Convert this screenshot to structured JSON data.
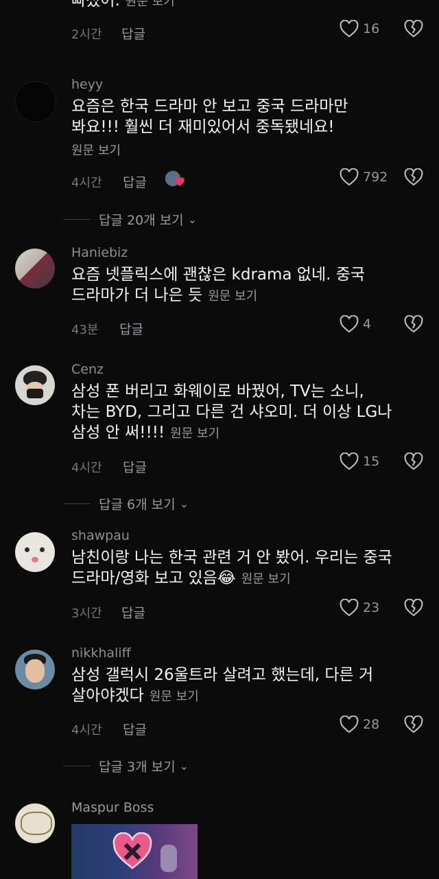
{
  "comments": [
    {
      "user": "",
      "text": "빠졌어.",
      "view_original": "원문 보기",
      "time": "2시간",
      "reply": "답글",
      "likes": "16"
    },
    {
      "user": "heyy",
      "text_line1": "요즘은 한국 드라마 안 보고 중국 드라마만",
      "text_line2": "봐요!!! 훨씬 더 재미있어서 중독됐네요!",
      "view_original": "원문 보기",
      "time": "4시간",
      "reply": "답글",
      "likes": "792",
      "view_replies": "답글 20개 보기"
    },
    {
      "user": "Haniebiz",
      "text_line1": "요즘 넷플릭스에 괜찮은 kdrama 없네. 중국",
      "text_line2": "드라마가 더 나은 듯",
      "view_original": "원문 보기",
      "time": "43분",
      "reply": "답글",
      "likes": "4"
    },
    {
      "user": "Cenz",
      "text_line1": "삼성 폰 버리고 화웨이로 바꿨어, TV는 소니,",
      "text_line2": "차는 BYD, 그리고 다른 건 샤오미. 더 이상 LG나",
      "text_line3": "삼성 안 써!!!!",
      "view_original": "원문 보기",
      "time": "4시간",
      "reply": "답글",
      "likes": "15",
      "view_replies": "답글 6개 보기"
    },
    {
      "user": "shawpau",
      "text_line1": "남친이랑 나는 한국 관련 거 안 봤어. 우리는 중국",
      "text_line2": "드라마/영화 보고 있음",
      "emoji": "😂",
      "view_original": "원문 보기",
      "time": "3시간",
      "reply": "답글",
      "likes": "23"
    },
    {
      "user": "nikkhaliff",
      "text_line1": "삼성 갤럭시 26울트라 살려고 했는데, 다른 거",
      "text_line2": "살아야겠다",
      "view_original": "원문 보기",
      "time": "4시간",
      "reply": "답글",
      "likes": "28",
      "view_replies": "답글 3개 보기"
    },
    {
      "user": "Maspur Boss"
    }
  ],
  "icons": {
    "like": "heart-outline-icon",
    "dislike": "broken-heart-icon",
    "chevron": "chevron-down-icon"
  },
  "colors": {
    "background": "#0b0b0c",
    "text": "#f2f2f2",
    "muted": "#9a9a9e",
    "accent": "#e8356b"
  }
}
